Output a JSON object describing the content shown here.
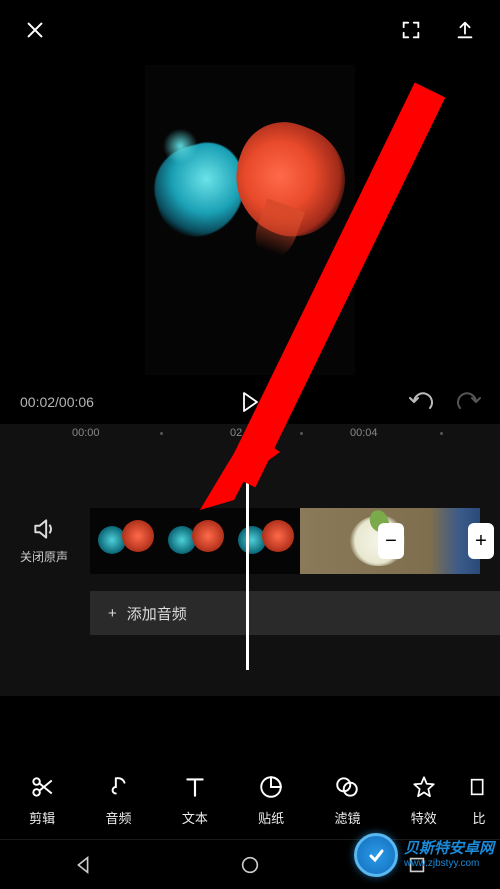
{
  "topbar": {
    "close": "close-icon",
    "fullscreen": "fullscreen-icon",
    "export": "export-icon"
  },
  "controls": {
    "time_current": "00:02",
    "time_total": "00:06",
    "time_display": "00:02/00:06"
  },
  "ruler": {
    "t0": "00:00",
    "t2": "02",
    "t4": "00:04"
  },
  "timeline": {
    "mute_label": "关闭原声",
    "minus": "−",
    "plus": "+",
    "add_audio_label": "添加音频",
    "add_plus": "+"
  },
  "toolbar": [
    {
      "icon": "scissors",
      "label": "剪辑"
    },
    {
      "icon": "music-note",
      "label": "音频"
    },
    {
      "icon": "text-t",
      "label": "文本"
    },
    {
      "icon": "sticker",
      "label": "贴纸"
    },
    {
      "icon": "filter-rings",
      "label": "滤镜"
    },
    {
      "icon": "star",
      "label": "特效"
    },
    {
      "icon": "ratio",
      "label": "比"
    }
  ],
  "watermark": {
    "title": "贝斯特安卓网",
    "url": "www.zjbstyy.com"
  }
}
